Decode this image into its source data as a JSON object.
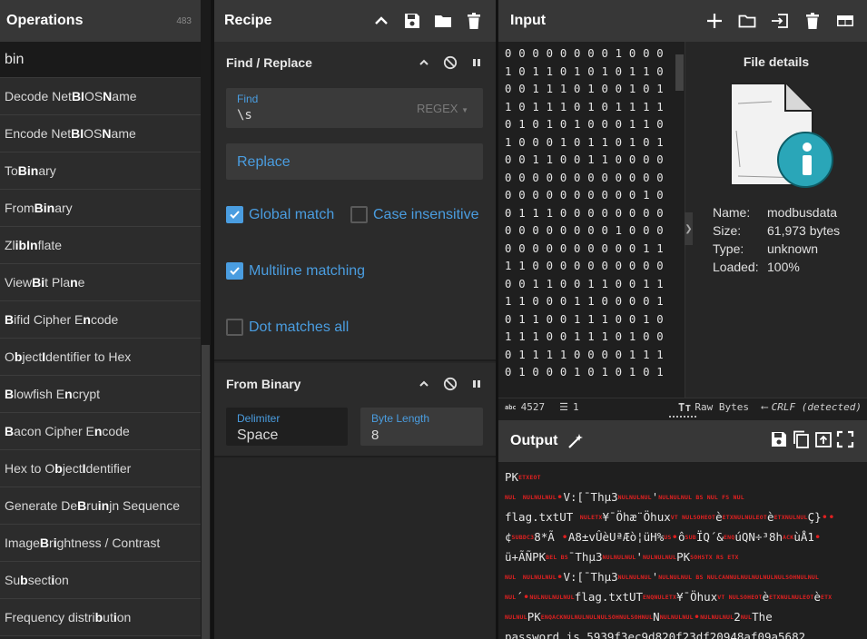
{
  "operations": {
    "title": "Operations",
    "count": "483",
    "search_value": "bin",
    "items": [
      {
        "pre": "Decode Net",
        "b": "BI",
        "mid": "OS ",
        "b2": "N",
        "post": "ame"
      },
      {
        "pre": "Encode Net",
        "b": "BI",
        "mid": "OS ",
        "b2": "N",
        "post": "ame"
      },
      {
        "pre": "To ",
        "b": "Bin",
        "mid": "ary",
        "b2": "",
        "post": ""
      },
      {
        "pre": "From ",
        "b": "Bin",
        "mid": "ary",
        "b2": "",
        "post": ""
      },
      {
        "pre": "Zl",
        "b": "ib",
        "mid": " ",
        "b2": "In",
        "post": "flate"
      },
      {
        "pre": "View ",
        "b": "Bi",
        "mid": "t Pla",
        "b2": "n",
        "post": "e"
      },
      {
        "pre": "",
        "b": "B",
        "mid": "ifid Cipher E",
        "b2": "n",
        "post": "code"
      },
      {
        "pre": "O",
        "b": "b",
        "mid": "ject ",
        "b2": "I",
        "post": "dentifier to Hex"
      },
      {
        "pre": "",
        "b": "B",
        "mid": "lowfish E",
        "b2": "n",
        "post": "crypt"
      },
      {
        "pre": "",
        "b": "B",
        "mid": "acon Cipher E",
        "b2": "n",
        "post": "code"
      },
      {
        "pre": "Hex to O",
        "b": "b",
        "mid": "ject ",
        "b2": "I",
        "post": "dentifier"
      },
      {
        "pre": "Generate De ",
        "b": "B",
        "mid": "ru",
        "b2": "in",
        "post": "jn Sequence"
      },
      {
        "pre": "Image ",
        "b": "B",
        "mid": "r",
        "b2": "i",
        "post": "ghtness / Contrast"
      },
      {
        "pre": "Su",
        "b": "b",
        "mid": "sect",
        "b2": "i",
        "post": "on"
      },
      {
        "pre": "Frequency distri",
        "b": "b",
        "mid": "ut",
        "b2": "i",
        "post": "on"
      }
    ]
  },
  "recipe": {
    "title": "Recipe",
    "find_replace": {
      "name": "Find / Replace",
      "find_label": "Find",
      "find_value": "\\s",
      "find_mode": "REGEX",
      "replace_placeholder": "Replace",
      "global_match": "Global match",
      "case_insensitive": "Case insensitive",
      "multiline": "Multiline matching",
      "dot_all": "Dot matches all"
    },
    "from_binary": {
      "name": "From Binary",
      "delimiter_label": "Delimiter",
      "delimiter_value": "Space",
      "byte_length_label": "Byte Length",
      "byte_length_value": "8"
    }
  },
  "input": {
    "title": "Input",
    "text": "0 0 0 0 0 0 0 0 1 0 0 0\n1 0 1 1 0 1 0 1 0 1 1 0\n0 0 1 1 1 0 1 0 0 1 0 1\n1 0 1 1 1 0 1 0 1 1 1 1\n0 1 0 1 0 1 0 0 0 1 1 0\n1 0 0 0 1 0 1 1 0 1 0 1\n0 0 1 1 0 0 1 1 0 0 0 0\n0 0 0 0 0 0 0 0 0 0 0 0\n0 0 0 0 0 0 0 0 0 0 1 0\n0 1 1 1 0 0 0 0 0 0 0 0\n0 0 0 0 0 0 0 0 1 0 0 0\n0 0 0 0 0 0 0 0 0 0 1 1\n1 1 0 0 0 0 0 0 0 0 0 0\n0 0 1 1 0 0 1 1 0 0 1 1\n1 1 0 0 0 1 1 0 0 0 0 1\n0 1 1 0 0 1 1 1 0 0 1 0\n1 1 1 0 0 1 1 1 0 1 0 0\n0 1 1 1 1 0 0 0 0 1 1 1\n0 1 0 0 0 1 0 1 0 1 0 1",
    "file_details": {
      "title": "File details",
      "name_label": "Name:",
      "name": "modbusdata",
      "size_label": "Size:",
      "size": "61,973 bytes",
      "type_label": "Type:",
      "type": "unknown",
      "loaded_label": "Loaded:",
      "loaded": "100%"
    },
    "status": {
      "abc_icon": "abc",
      "length": "4527",
      "lines": "1",
      "raw_bytes": "Raw Bytes",
      "eol": "CRLF (detected)"
    }
  },
  "output": {
    "title": "Output",
    "lines": [
      [
        [
          "t",
          "PK"
        ],
        [
          "c",
          "ETXEOT"
        ]
      ],
      [
        [
          "c",
          "NUL"
        ],
        [
          "t",
          "  "
        ],
        [
          "c",
          "NULNULNUL"
        ],
        [
          "r",
          "•"
        ],
        [
          "t",
          "V:[¯Thµ3"
        ],
        [
          "c",
          "NULNULNUL"
        ],
        [
          "t",
          "'"
        ],
        [
          "c",
          "NULNULNUL BS NUL FS NUL"
        ]
      ],
      [
        [
          "t",
          "flag.txtUT  "
        ],
        [
          "c",
          "NULETX"
        ],
        [
          "t",
          "¥¯Öhæ¨Öhux"
        ],
        [
          "c",
          "VT NULSOHEOT"
        ],
        [
          "t",
          "è"
        ],
        [
          "c",
          "ETXNULNULEOT"
        ],
        [
          "t",
          "è"
        ],
        [
          "c",
          "ETXNULNUL"
        ],
        [
          "t",
          "Ç}"
        ],
        [
          "r",
          "••"
        ]
      ],
      [
        [
          "t",
          "¢"
        ],
        [
          "c",
          "SUBDC3"
        ],
        [
          "t",
          "8*Ã "
        ],
        [
          "r",
          "•"
        ],
        [
          "t",
          "A8±vÛèUªÆò¦üH%"
        ],
        [
          "c",
          "US"
        ],
        [
          "r",
          "•"
        ],
        [
          "t",
          "ô"
        ],
        [
          "c",
          "SUB"
        ],
        [
          "t",
          "ÏQ´&"
        ],
        [
          "c",
          "ENQ"
        ],
        [
          "t",
          "úQN÷³8h"
        ],
        [
          "c",
          "ACK"
        ],
        [
          "t",
          "ùÅ1"
        ],
        [
          "r",
          "•"
        ]
      ],
      [
        [
          "t",
          "ü+ÃÑPK"
        ],
        [
          "c",
          "BEL BS"
        ],
        [
          "t",
          "¯Thµ3"
        ],
        [
          "c",
          "NULNULNUL"
        ],
        [
          "t",
          "'"
        ],
        [
          "c",
          "NULNULNUL"
        ],
        [
          "t",
          "PK"
        ],
        [
          "c",
          "SOHSTX RS ETX"
        ]
      ],
      [
        [
          "c",
          "NUL"
        ],
        [
          "t",
          "  "
        ],
        [
          "c",
          "NULNULNUL"
        ],
        [
          "r",
          "•"
        ],
        [
          "t",
          "V:[¯Thµ3"
        ],
        [
          "c",
          "NULNULNUL"
        ],
        [
          "t",
          "'"
        ],
        [
          "c",
          "NULNULNUL BS NULCANNULNULNULNULNULSOHNULNUL"
        ]
      ],
      [
        [
          "c",
          "NUL"
        ],
        [
          "t",
          "´"
        ],
        [
          "r",
          "•"
        ],
        [
          "c",
          "NULNULNULNUL"
        ],
        [
          "t",
          "flag.txtUT"
        ],
        [
          "c",
          "ENQNULETX"
        ],
        [
          "t",
          "¥¯Öhux"
        ],
        [
          "c",
          "VT NULSOHEOT"
        ],
        [
          "t",
          "è"
        ],
        [
          "c",
          "ETXNULNULEOT"
        ],
        [
          "t",
          "è"
        ],
        [
          "c",
          "ETX"
        ]
      ],
      [
        [
          "c",
          "NULNUL"
        ],
        [
          "t",
          "PK"
        ],
        [
          "c",
          "ENQACKNULNULNULNULSOHNULSOHNUL"
        ],
        [
          "t",
          "N"
        ],
        [
          "c",
          "NULNULNUL"
        ],
        [
          "r",
          "•"
        ],
        [
          "c",
          "NULNULNUL"
        ],
        [
          "t",
          "2"
        ],
        [
          "c",
          "NUL"
        ],
        [
          "t",
          "The"
        ]
      ],
      [
        [
          "t",
          "password is 5939f3ec9d820f23df20948af09a5682 ."
        ]
      ]
    ]
  }
}
